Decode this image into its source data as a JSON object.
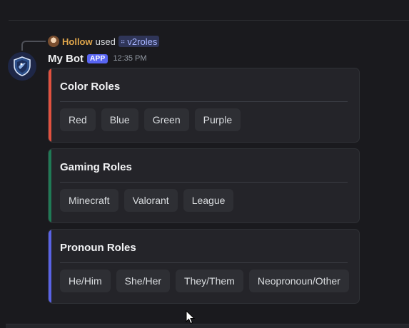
{
  "reply": {
    "user": "Hollow",
    "used_text": "used",
    "command": "v2roles"
  },
  "message": {
    "bot_name": "My Bot",
    "badge": "APP",
    "timestamp": "12:35 PM"
  },
  "containers": [
    {
      "title": "Color Roles",
      "accent_color": "#e2513f",
      "buttons": [
        "Red",
        "Blue",
        "Green",
        "Purple"
      ]
    },
    {
      "title": "Gaming Roles",
      "accent_color": "#1f7a55",
      "buttons": [
        "Minecraft",
        "Valorant",
        "League"
      ]
    },
    {
      "title": "Pronoun Roles",
      "accent_color": "#5a63e6",
      "buttons": [
        "He/Him",
        "She/Her",
        "They/Them",
        "Neopronoun/Other"
      ]
    }
  ],
  "icons": {
    "reply_avatar": "user-avatar",
    "bot_avatar": "shield-logo-avatar",
    "command": "slash-command-icon",
    "cursor": "mouse-pointer-icon"
  }
}
